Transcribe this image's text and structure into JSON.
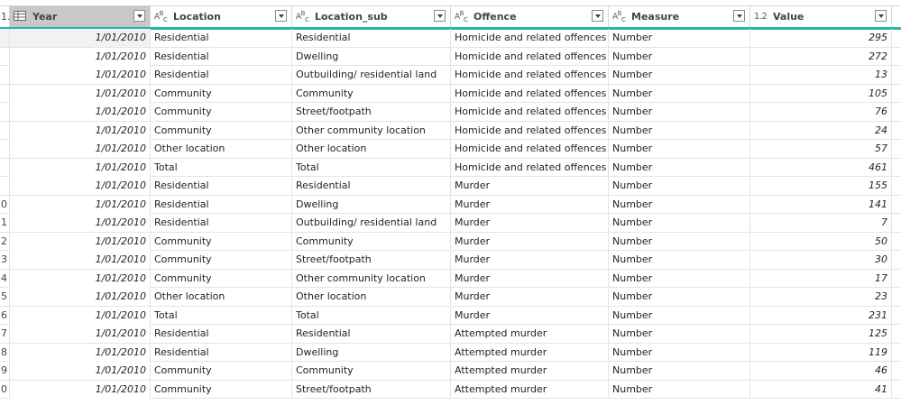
{
  "header": {
    "index_corner": "1.",
    "columns": [
      {
        "key": "year",
        "label": "Year",
        "type_icon": "table-icon"
      },
      {
        "key": "location",
        "label": "Location",
        "type_icon": "ABC"
      },
      {
        "key": "location_sub",
        "label": "Location_sub",
        "type_icon": "ABC"
      },
      {
        "key": "offence",
        "label": "Offence",
        "type_icon": "ABC"
      },
      {
        "key": "measure",
        "label": "Measure",
        "type_icon": "ABC"
      },
      {
        "key": "value",
        "label": "Value",
        "type_icon": "1.2"
      }
    ]
  },
  "rows": [
    {
      "idx": "",
      "year": "1/01/2010",
      "location": "Residential",
      "location_sub": "Residential",
      "offence": "Homicide and related offences",
      "measure": "Number",
      "value": "295"
    },
    {
      "idx": "",
      "year": "1/01/2010",
      "location": "Residential",
      "location_sub": "Dwelling",
      "offence": "Homicide and related offences",
      "measure": "Number",
      "value": "272"
    },
    {
      "idx": "",
      "year": "1/01/2010",
      "location": "Residential",
      "location_sub": "Outbuilding/ residential land",
      "offence": "Homicide and related offences",
      "measure": "Number",
      "value": "13"
    },
    {
      "idx": "",
      "year": "1/01/2010",
      "location": "Community",
      "location_sub": "Community",
      "offence": "Homicide and related offences",
      "measure": "Number",
      "value": "105"
    },
    {
      "idx": "",
      "year": "1/01/2010",
      "location": "Community",
      "location_sub": "Street/footpath",
      "offence": "Homicide and related offences",
      "measure": "Number",
      "value": "76"
    },
    {
      "idx": "",
      "year": "1/01/2010",
      "location": "Community",
      "location_sub": "Other community location",
      "offence": "Homicide and related offences",
      "measure": "Number",
      "value": "24"
    },
    {
      "idx": "",
      "year": "1/01/2010",
      "location": "Other location",
      "location_sub": "Other location",
      "offence": "Homicide and related offences",
      "measure": "Number",
      "value": "57"
    },
    {
      "idx": "",
      "year": "1/01/2010",
      "location": "Total",
      "location_sub": "Total",
      "offence": "Homicide and related offences",
      "measure": "Number",
      "value": "461"
    },
    {
      "idx": "",
      "year": "1/01/2010",
      "location": "Residential",
      "location_sub": "Residential",
      "offence": "Murder",
      "measure": "Number",
      "value": "155"
    },
    {
      "idx": "0",
      "year": "1/01/2010",
      "location": "Residential",
      "location_sub": "Dwelling",
      "offence": "Murder",
      "measure": "Number",
      "value": "141"
    },
    {
      "idx": "1",
      "year": "1/01/2010",
      "location": "Residential",
      "location_sub": "Outbuilding/ residential land",
      "offence": "Murder",
      "measure": "Number",
      "value": "7"
    },
    {
      "idx": "2",
      "year": "1/01/2010",
      "location": "Community",
      "location_sub": "Community",
      "offence": "Murder",
      "measure": "Number",
      "value": "50"
    },
    {
      "idx": "3",
      "year": "1/01/2010",
      "location": "Community",
      "location_sub": "Street/footpath",
      "offence": "Murder",
      "measure": "Number",
      "value": "30"
    },
    {
      "idx": "4",
      "year": "1/01/2010",
      "location": "Community",
      "location_sub": "Other community location",
      "offence": "Murder",
      "measure": "Number",
      "value": "17"
    },
    {
      "idx": "5",
      "year": "1/01/2010",
      "location": "Other location",
      "location_sub": "Other location",
      "offence": "Murder",
      "measure": "Number",
      "value": "23"
    },
    {
      "idx": "6",
      "year": "1/01/2010",
      "location": "Total",
      "location_sub": "Total",
      "offence": "Murder",
      "measure": "Number",
      "value": "231"
    },
    {
      "idx": "7",
      "year": "1/01/2010",
      "location": "Residential",
      "location_sub": "Residential",
      "offence": "Attempted murder",
      "measure": "Number",
      "value": "125"
    },
    {
      "idx": "8",
      "year": "1/01/2010",
      "location": "Residential",
      "location_sub": "Dwelling",
      "offence": "Attempted murder",
      "measure": "Number",
      "value": "119"
    },
    {
      "idx": "9",
      "year": "1/01/2010",
      "location": "Community",
      "location_sub": "Community",
      "offence": "Attempted murder",
      "measure": "Number",
      "value": "46"
    },
    {
      "idx": "0",
      "year": "1/01/2010",
      "location": "Community",
      "location_sub": "Street/footpath",
      "offence": "Attempted murder",
      "measure": "Number",
      "value": "41"
    }
  ],
  "colors": {
    "accent": "#27b6a6",
    "selected_header": "#c8c8c8"
  }
}
